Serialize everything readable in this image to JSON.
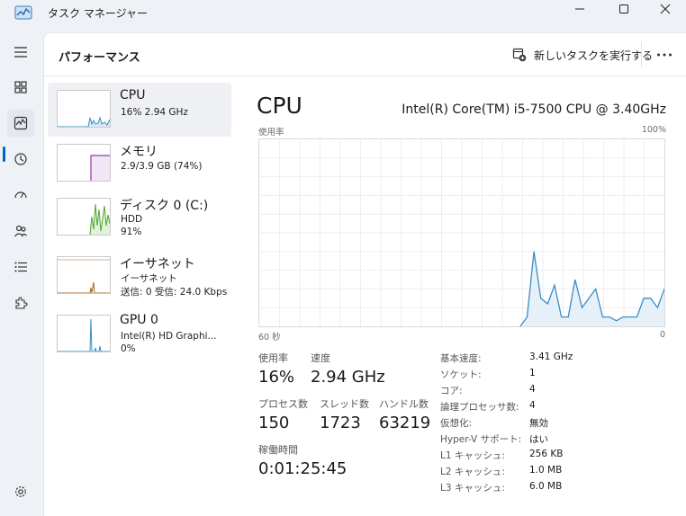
{
  "window": {
    "title": "タスク マネージャー"
  },
  "header": {
    "page_title": "パフォーマンス",
    "run_new_task": "新しいタスクを実行する",
    "more_label": "..."
  },
  "perf_items": [
    {
      "title": "CPU",
      "line1": "16%  2.94 GHz",
      "color": "#3b8cc4"
    },
    {
      "title": "メモリ",
      "line1": "2.9/3.9 GB (74%)",
      "color": "#8c3ca8"
    },
    {
      "title": "ディスク 0 (C:)",
      "line1": "HDD",
      "line2": "91%",
      "color": "#4ea72e"
    },
    {
      "title": "イーサネット",
      "line1": "イーサネット",
      "line2": "送信: 0 受信: 24.0 Kbps",
      "color": "#a8662b"
    },
    {
      "title": "GPU 0",
      "line1": "Intel(R) HD Graphi...",
      "line2": "0%",
      "color": "#3b8cc4"
    }
  ],
  "cpu_panel": {
    "title": "CPU",
    "model": "Intel(R) Core(TM) i5-7500 CPU @ 3.40GHz",
    "graph_label": "使用率",
    "graph_max": "100%",
    "graph_time_left": "60 秒",
    "graph_time_right": "0",
    "usage_label": "使用率",
    "usage_value": "16%",
    "speed_label": "速度",
    "speed_value": "2.94 GHz",
    "process_label": "プロセス数",
    "process_value": "150",
    "thread_label": "スレッド数",
    "thread_value": "1723",
    "handle_label": "ハンドル数",
    "handle_value": "63219",
    "uptime_label": "稼働時間",
    "uptime_value": "0:01:25:45"
  },
  "specs": [
    {
      "label": "基本速度:",
      "value": "3.41 GHz"
    },
    {
      "label": "ソケット:",
      "value": "1"
    },
    {
      "label": "コア:",
      "value": "4"
    },
    {
      "label": "論理プロセッサ数:",
      "value": "4"
    },
    {
      "label": "仮想化:",
      "value": "無効"
    },
    {
      "label": "Hyper-V サポート:",
      "value": "はい"
    },
    {
      "label": "L1 キャッシュ:",
      "value": "256 KB"
    },
    {
      "label": "L2 キャッシュ:",
      "value": "1.0 MB"
    },
    {
      "label": "L3 キャッシュ:",
      "value": "6.0 MB"
    }
  ],
  "cpu_history": [
    0,
    0,
    0,
    0,
    0,
    0,
    0,
    0,
    0,
    0,
    0,
    0,
    0,
    0,
    0,
    0,
    0,
    0,
    0,
    0,
    0,
    0,
    0,
    0,
    0,
    0,
    0,
    0,
    0,
    0,
    0,
    0,
    0,
    0,
    0,
    0,
    0,
    0,
    0,
    5,
    40,
    15,
    12,
    22,
    5,
    5,
    25,
    10,
    15,
    20,
    5,
    5,
    3,
    5,
    5,
    5,
    15,
    15,
    10,
    20
  ],
  "colors": {
    "accent": "#0067c0",
    "cpu": "#3b8cc4",
    "cpu_fill": "#e6f0f8"
  }
}
